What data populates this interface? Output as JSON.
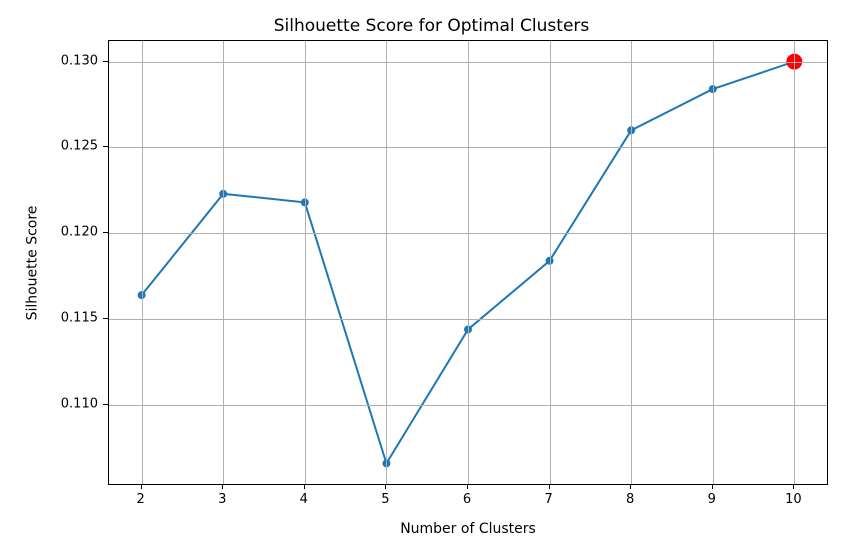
{
  "chart_data": {
    "type": "line",
    "title": "Silhouette Score for Optimal Clusters",
    "xlabel": "Number of Clusters",
    "ylabel": "Silhouette Score",
    "x": [
      2,
      3,
      4,
      5,
      6,
      7,
      8,
      9,
      10
    ],
    "values": [
      0.1164,
      0.1223,
      0.1218,
      0.1066,
      0.1144,
      0.1184,
      0.126,
      0.1284,
      0.13
    ],
    "xticks": [
      2,
      3,
      4,
      5,
      6,
      7,
      8,
      9,
      10
    ],
    "yticks": [
      0.11,
      0.115,
      0.12,
      0.125,
      0.13
    ],
    "xlim": [
      1.6,
      10.4
    ],
    "ylim": [
      0.1054,
      0.1312
    ],
    "highlight": {
      "x": 10,
      "y": 0.13,
      "color": "#ff0000",
      "size": 200
    },
    "line_color": "#1f77b4",
    "marker_color": "#1f77b4"
  }
}
